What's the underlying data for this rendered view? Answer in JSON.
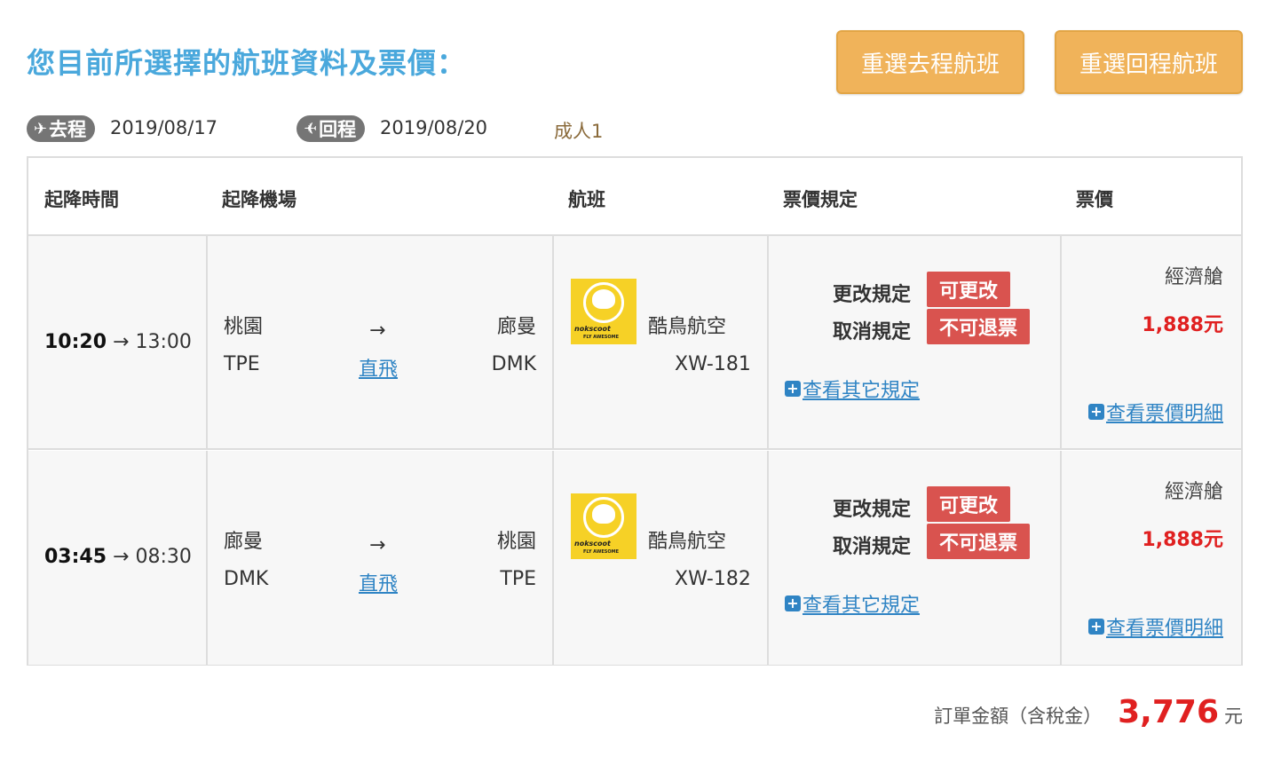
{
  "header": {
    "title": "您目前所選擇的航班資料及票價：",
    "reselect_outbound": "重選去程航班",
    "reselect_return": "重選回程航班"
  },
  "trip": {
    "outbound_label": "去程",
    "outbound_date": "2019/08/17",
    "return_label": "回程",
    "return_date": "2019/08/20",
    "passengers": "成人1"
  },
  "table": {
    "columns": [
      "起降時間",
      "起降機場",
      "航班",
      "票價規定",
      "票價"
    ]
  },
  "flights": [
    {
      "depart_time": "10:20",
      "arrive_time": "13:00",
      "from_city": "桃園",
      "from_code": "TPE",
      "to_city": "廊曼",
      "to_code": "DMK",
      "route_type": "直飛",
      "airline": "酷鳥航空",
      "flight_no": "XW-181",
      "change_label": "更改規定",
      "change_value": "可更改",
      "cancel_label": "取消規定",
      "cancel_value": "不可退票",
      "more_rules": "查看其它規定",
      "cabin": "經濟艙",
      "price": "1,888元",
      "price_detail": "查看票價明細"
    },
    {
      "depart_time": "03:45",
      "arrive_time": "08:30",
      "from_city": "廊曼",
      "from_code": "DMK",
      "to_city": "桃園",
      "to_code": "TPE",
      "route_type": "直飛",
      "airline": "酷鳥航空",
      "flight_no": "XW-182",
      "change_label": "更改規定",
      "change_value": "可更改",
      "cancel_label": "取消規定",
      "cancel_value": "不可退票",
      "more_rules": "查看其它規定",
      "cabin": "經濟艙",
      "price": "1,888元",
      "price_detail": "查看票價明細"
    }
  ],
  "logo": {
    "brand": "nokscoot",
    "tagline": "FLY AWESOME"
  },
  "summary": {
    "label": "訂單金額（含稅金）",
    "amount": "3,776",
    "unit": "元"
  },
  "colors": {
    "title_blue": "#4aa8dc",
    "button_orange": "#f0b35a",
    "badge_red": "#d9534f",
    "price_red": "#e02020",
    "link_blue": "#2f84c4"
  }
}
